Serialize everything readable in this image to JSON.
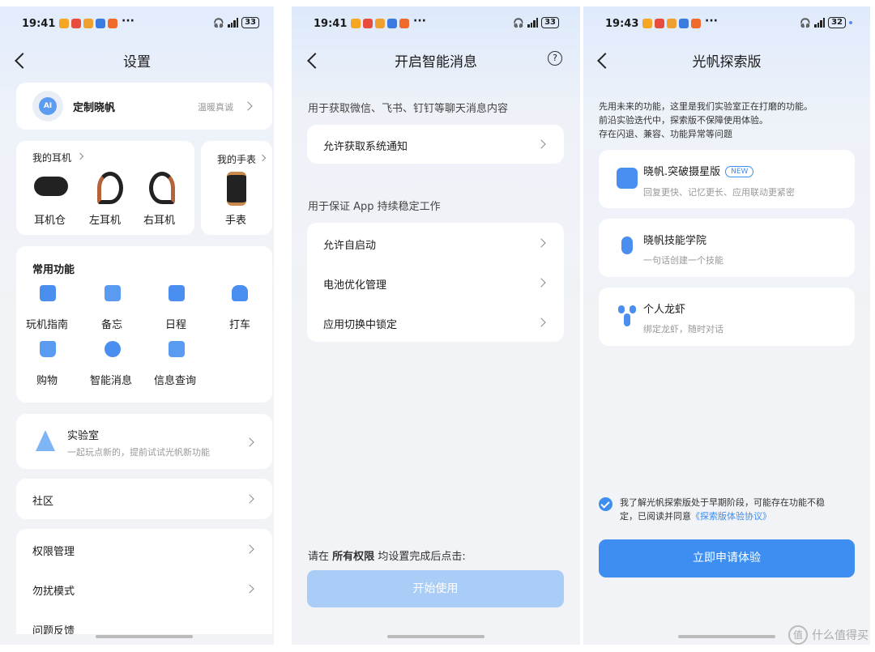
{
  "colors": {
    "accent": "#3d8ef0",
    "accent_light": "#a9cdf6",
    "page_bg": "#f1f3f6"
  },
  "screen1": {
    "status": {
      "time": "19:41",
      "battery": "33"
    },
    "title": "设置",
    "profile": {
      "name": "定制晓帆",
      "avatar_text": "AI",
      "right": "温暖真诚"
    },
    "earphones": {
      "title": "我的耳机",
      "items": [
        "耳机仓",
        "左耳机",
        "右耳机"
      ]
    },
    "watch": {
      "title": "我的手表",
      "item": "手表"
    },
    "common": {
      "title": "常用功能",
      "items": [
        "玩机指南",
        "备忘",
        "日程",
        "打车",
        "购物",
        "智能消息",
        "信息查询"
      ]
    },
    "lab": {
      "title": "实验室",
      "subtitle": "一起玩点新的，提前试试光帆新功能"
    },
    "community": "社区",
    "settings": [
      "权限管理",
      "勿扰模式",
      "问题反馈"
    ]
  },
  "screen2": {
    "status": {
      "time": "19:41",
      "battery": "33"
    },
    "title": "开启智能消息",
    "help_icon": "?",
    "section1": {
      "label": "用于获取微信、飞书、钉钉等聊天消息内容",
      "items": [
        "允许获取系统通知"
      ]
    },
    "section2": {
      "label": "用于保证 App 持续稳定工作",
      "items": [
        "允许自启动",
        "电池优化管理",
        "应用切换中锁定"
      ]
    },
    "footer": {
      "prefix": "请在",
      "bold": "所有权限",
      "suffix": "均设置完成后点击:"
    },
    "button": "开始使用"
  },
  "screen3": {
    "status": {
      "time": "19:43",
      "battery": "32"
    },
    "title": "光帆探索版",
    "intro": [
      "先用未来的功能，这里是我们实验室正在打磨的功能。",
      "前沿实验迭代中，探索版不保障使用体验。",
      "存在闪退、兼容、功能异常等问题"
    ],
    "features": [
      {
        "title": "晓帆.突破摄星版",
        "badge": "NEW",
        "subtitle": "回复更快、记忆更长、应用联动更紧密"
      },
      {
        "title": "晓帆技能学院",
        "subtitle": "一句话创建一个技能"
      },
      {
        "title": "个人龙虾",
        "subtitle": "绑定龙虾，随时对话"
      }
    ],
    "agreement": {
      "text_line1": "我了解光帆探索版处于早期阶段，可能存在功能不稳",
      "text_line2": "定，已阅读并同意",
      "link": "《探索版体验协议》"
    },
    "button": "立即申请体验"
  },
  "watermark": {
    "logo": "值",
    "text": "什么值得买"
  }
}
